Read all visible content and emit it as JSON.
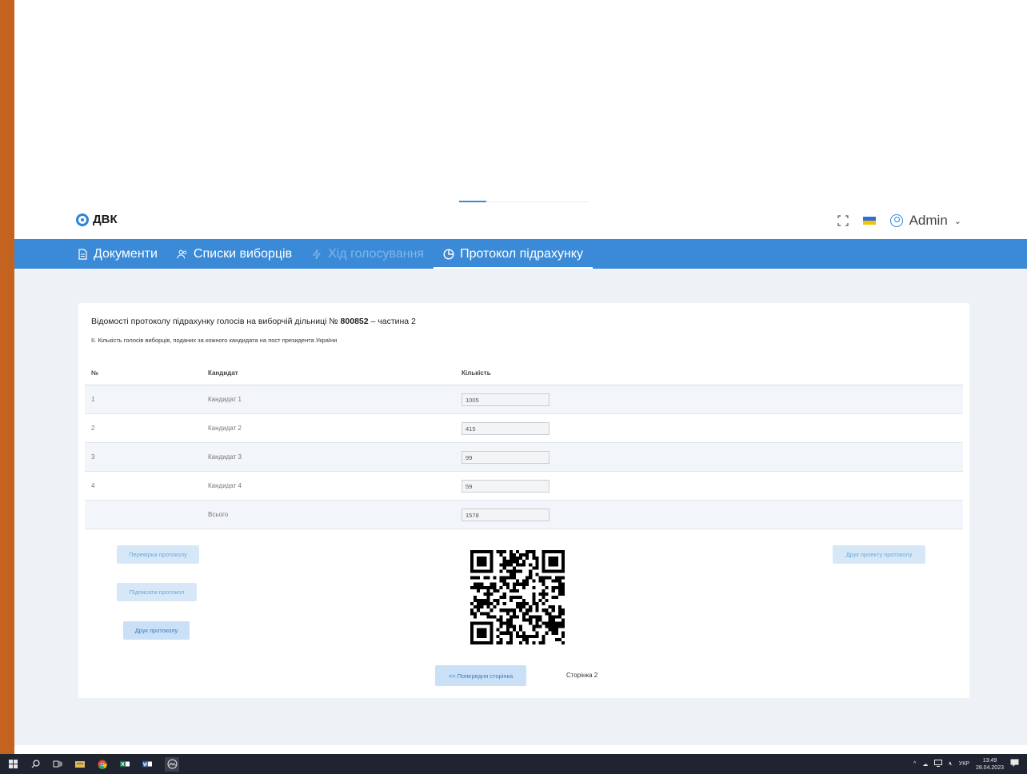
{
  "app": {
    "logo_text": "ДВК"
  },
  "header": {
    "user_name": "Admin",
    "colors": {
      "flag_top": "#2f6ed8",
      "flag_bottom": "#f5c400"
    }
  },
  "nav": {
    "items": [
      {
        "label": "Документи",
        "icon": "document-icon",
        "state": "normal"
      },
      {
        "label": "Списки виборців",
        "icon": "users-icon",
        "state": "normal"
      },
      {
        "label": "Хід голосування",
        "icon": "lightning-icon",
        "state": "disabled"
      },
      {
        "label": "Протокол підрахунку",
        "icon": "pie-chart-icon",
        "state": "active"
      }
    ],
    "accent_color": "#3a8ad8"
  },
  "protocol": {
    "title_prefix": "Відомості протоколу підрахунку голосів на виборчій дільниці №",
    "district_number": "800852",
    "title_suffix": "– частина 2",
    "subtitle": "ІІ. Кількість голосів виборців, поданих за кожного кандидата на пост президента України",
    "columns": [
      "№",
      "Кандидат",
      "Кількість"
    ],
    "rows": [
      {
        "num": "1",
        "candidate": "Кандидат 1",
        "count": "1005"
      },
      {
        "num": "2",
        "candidate": "Кандидат 2",
        "count": "415"
      },
      {
        "num": "3",
        "candidate": "Кандидат 3",
        "count": "99"
      },
      {
        "num": "4",
        "candidate": "Кандидат 4",
        "count": "59"
      }
    ],
    "total": {
      "label": "Всього",
      "count": "1578"
    }
  },
  "actions": {
    "check_protocol": "Перевірка протоколу",
    "sign_protocol": "Підписати протокол",
    "print_protocol": "Друк протоколу",
    "print_draft": "Друк проекту протоколу",
    "prev_page": "<< Попередня сторінка",
    "page_label": "Сторінка 2"
  },
  "taskbar": {
    "language": "УКР",
    "time": "13:49",
    "date": "28.04.2023"
  }
}
